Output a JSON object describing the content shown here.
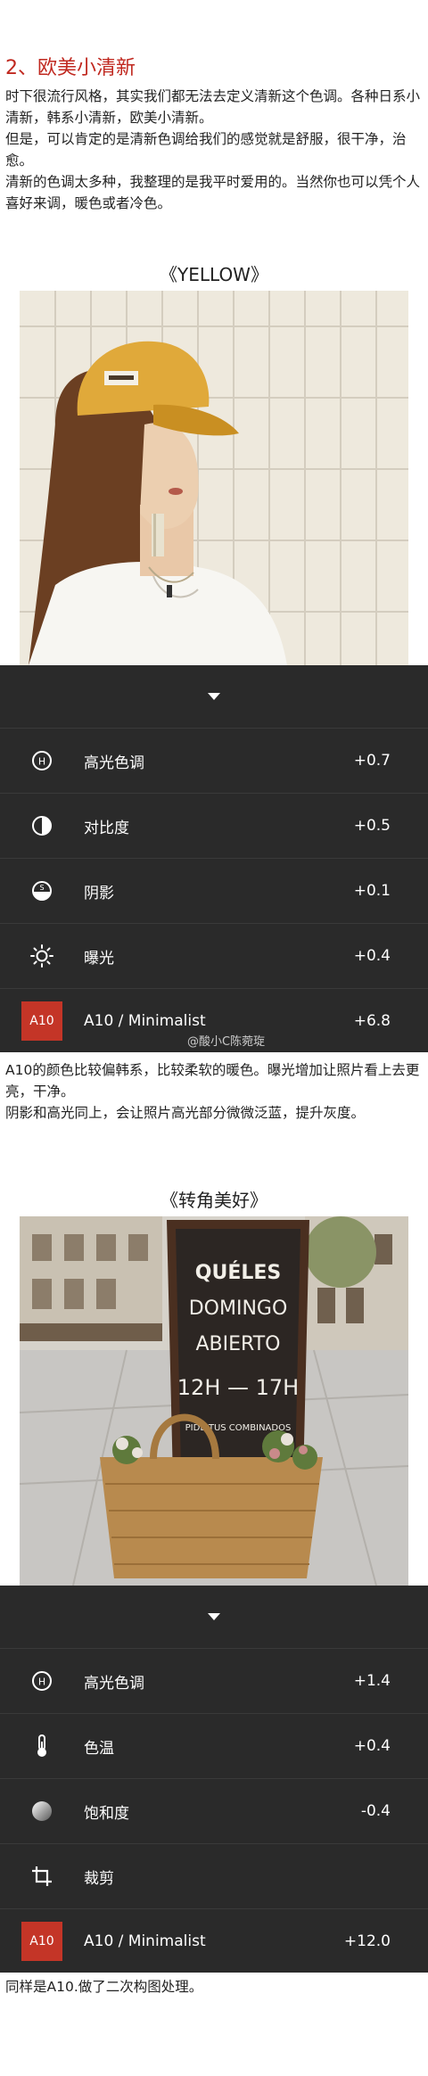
{
  "article": {
    "section_title": "2、欧美小清新",
    "p1": "时下很流行风格，其实我们都无法去定义清新这个色调。各种日系小清新，韩系小清新，欧美小清新。",
    "p2": "但是，可以肯定的是清新色调给我们的感觉就是舒服，很干净，治愈。",
    "p3": "清新的色调太多种，我整理的是我平时爱用的。当然你也可以凭个人喜好来调，暖色或者冷色。"
  },
  "example1": {
    "caption": "《YELLOW》",
    "photo_icon": "photo-woman-yellow-cap",
    "rows": [
      {
        "icon": "highlights-icon",
        "label": "高光色调",
        "value": "+0.7"
      },
      {
        "icon": "contrast-icon",
        "label": "对比度",
        "value": "+0.5"
      },
      {
        "icon": "shadows-icon",
        "label": "阴影",
        "value": "+0.1"
      },
      {
        "icon": "exposure-icon",
        "label": "曝光",
        "value": "+0.4"
      },
      {
        "badge": "A10",
        "label": "A10 / Minimalist",
        "value": "+6.8",
        "watermark": "@酸小C陈菀琁"
      }
    ],
    "note1": "A10的颜色比较偏韩系，比较柔软的暖色。曝光增加让照片看上去更亮，干净。",
    "note2": "阴影和高光同上，会让照片高光部分微微泛蓝，提升灰度。"
  },
  "example2": {
    "caption": "《转角美好》",
    "photo_icon": "photo-chalkboard-street",
    "board_text": [
      "QUÉLES",
      "DOMINGO",
      "ABIERTO",
      "12H — 17H",
      "PIDE TUS COMBINADOS"
    ],
    "rows": [
      {
        "icon": "highlights-icon",
        "label": "高光色调",
        "value": "+1.4"
      },
      {
        "icon": "temperature-icon",
        "label": "色温",
        "value": "+0.4"
      },
      {
        "icon": "saturation-icon",
        "label": "饱和度",
        "value": "-0.4"
      },
      {
        "icon": "crop-icon",
        "label": "裁剪",
        "value": ""
      },
      {
        "badge": "A10",
        "label": "A10 / Minimalist",
        "value": "+12.0"
      }
    ],
    "note": "同样是A10.做了二次构图处理。"
  },
  "colors": {
    "accent_red": "#c0281f",
    "panel_bg": "#2a2a2a",
    "badge_red": "#c43527",
    "cap_yellow": "#e0a93a"
  }
}
